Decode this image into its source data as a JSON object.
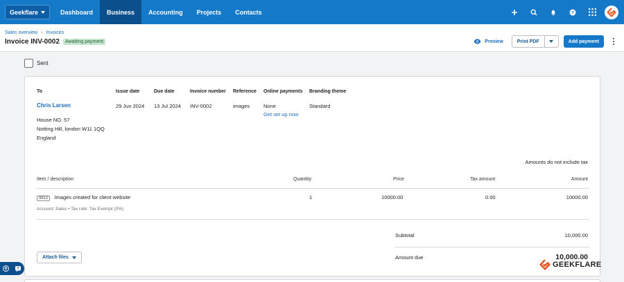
{
  "nav": {
    "org_label": "Geekflare",
    "tabs": [
      "Dashboard",
      "Business",
      "Accounting",
      "Projects",
      "Contacts"
    ],
    "active_tab": "Business",
    "icons": [
      "plus-icon",
      "search-icon",
      "bell-icon",
      "help-icon",
      "apps-grid-icon",
      "geekflare-logo"
    ]
  },
  "header": {
    "breadcrumb": [
      "Sales overview",
      "Invoices"
    ],
    "title": "Invoice INV-0002",
    "status": "Awaiting payment",
    "preview_label": "Preview",
    "print_label": "Print PDF",
    "add_payment_label": "Add payment"
  },
  "sent_label": "Sent",
  "invoice": {
    "headers": {
      "to": "To",
      "issue_date": "Issue date",
      "due_date": "Due date",
      "invoice_number": "Invoice number",
      "reference": "Reference",
      "online_payments": "Online payments",
      "branding_theme": "Branding theme"
    },
    "contact_name": "Chris Larsen",
    "address": [
      "House NO. 57",
      "Notting Hill, london W11 1QQ",
      "England"
    ],
    "issue_date": "29 Jun 2024",
    "due_date": "13 Jul 2024",
    "invoice_number": "INV-0002",
    "reference": "images",
    "online_payments": "None",
    "online_payments_link": "Get set up now",
    "branding_theme": "Standard",
    "tax_note": "Amounts do not include tax",
    "line_headers": {
      "item": "Item / description",
      "quantity": "Quantity",
      "price": "Price",
      "tax": "Tax amount",
      "amount": "Amount"
    },
    "lines": [
      {
        "code": "9812",
        "description": "Images created for client website",
        "quantity": "1",
        "price": "10000.00",
        "tax": "0.00",
        "amount": "10000.00",
        "meta": "Account: Sales • Tax rate: Tax Exempt (0%)"
      }
    ],
    "subtotal_label": "Subtotal",
    "subtotal": "10,000.00",
    "amount_due_label": "Amount due",
    "amount_due": "10,000.00",
    "attach_label": "Attach files"
  },
  "watermark": "GEEKFLARE",
  "colors": {
    "nav_bg": "#1479c9",
    "nav_active": "#0b4f8c",
    "link": "#1b6dbe",
    "badge_bg": "#c6e7cf",
    "brand_orange": "#e8541e"
  }
}
